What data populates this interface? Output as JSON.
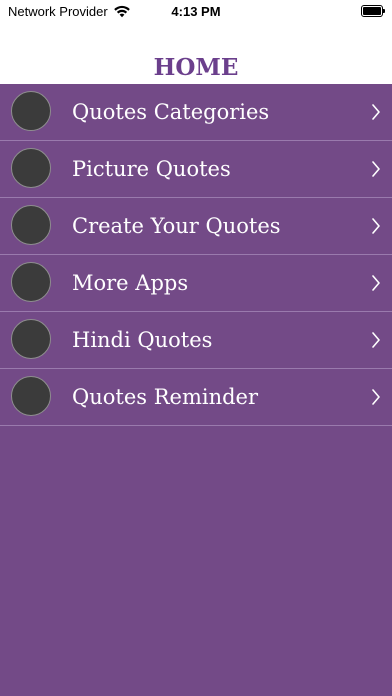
{
  "status_bar": {
    "carrier": "Network Provider",
    "time": "4:13 PM",
    "battery_level": 1.0
  },
  "header": {
    "title": "HOME"
  },
  "menu": {
    "items": [
      {
        "label": "Quotes Categories",
        "icon": "circle-avatar-icon"
      },
      {
        "label": "Picture Quotes",
        "icon": "circle-avatar-icon"
      },
      {
        "label": "Create Your Quotes",
        "icon": "circle-avatar-icon"
      },
      {
        "label": "More Apps",
        "icon": "circle-avatar-icon"
      },
      {
        "label": "Hindi Quotes",
        "icon": "circle-avatar-icon"
      },
      {
        "label": "Quotes Reminder",
        "icon": "circle-avatar-icon"
      }
    ]
  },
  "colors": {
    "background": "#734a87",
    "title": "#6b3f8c",
    "divider": "#9a7aad",
    "icon_fill": "#3b3b3b"
  }
}
